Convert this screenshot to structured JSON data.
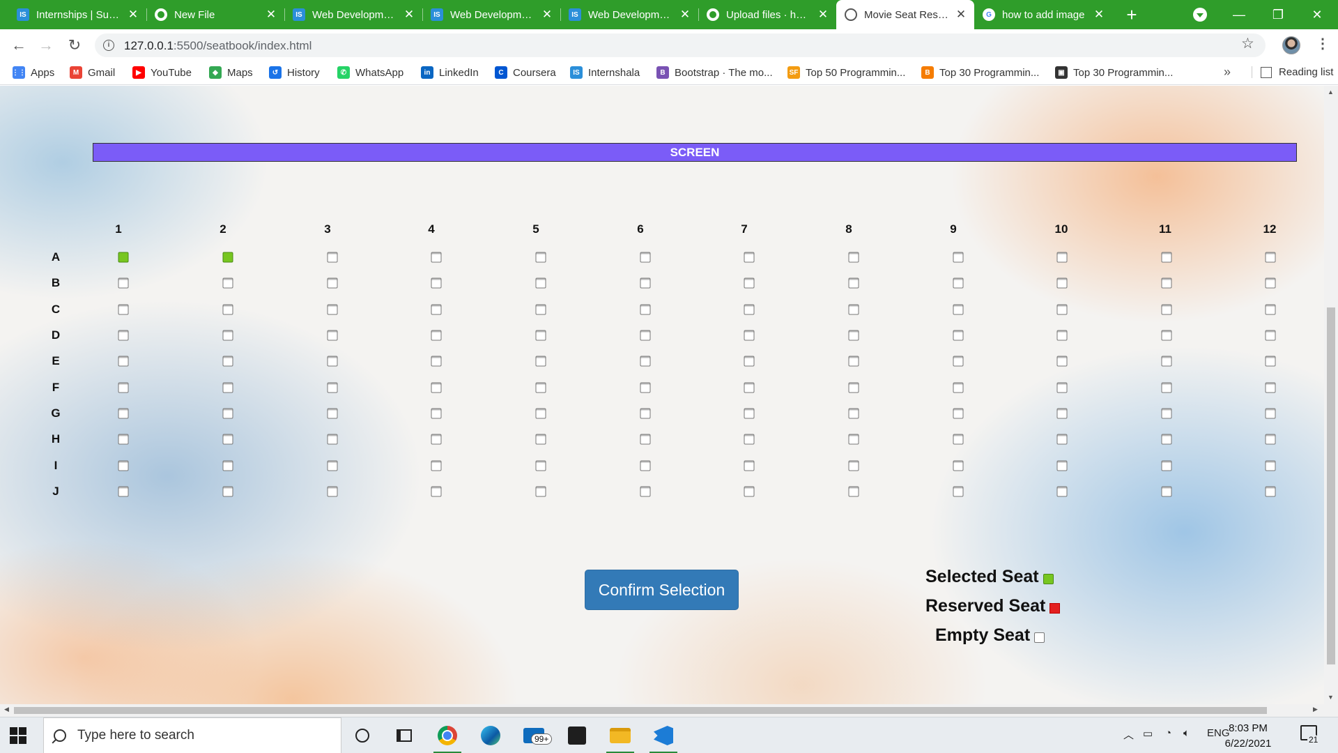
{
  "browser": {
    "tabs": [
      {
        "title": "Internships | Summer",
        "icon": "internshala-icon"
      },
      {
        "title": "New File",
        "icon": "github-icon"
      },
      {
        "title": "Web Development",
        "icon": "internshala-icon"
      },
      {
        "title": "Web Development",
        "icon": "internshala-icon"
      },
      {
        "title": "Web Development",
        "icon": "internshala-icon"
      },
      {
        "title": "Upload files · harsh",
        "icon": "github-icon"
      },
      {
        "title": "Movie Seat Reservation",
        "icon": "globe-icon",
        "active": true
      },
      {
        "title": "how to add image",
        "icon": "google-icon"
      }
    ],
    "url_host": "127.0.0.1",
    "url_path": ":5500/seatbook/index.html",
    "bookmarks": [
      {
        "label": "Apps",
        "color": "#4285f4",
        "glyph": "⋮⋮"
      },
      {
        "label": "Gmail",
        "color": "#ea4335",
        "glyph": "M"
      },
      {
        "label": "YouTube",
        "color": "#ff0000",
        "glyph": "▶"
      },
      {
        "label": "Maps",
        "color": "#34a853",
        "glyph": "◆"
      },
      {
        "label": "History",
        "color": "#1a73e8",
        "glyph": "↺"
      },
      {
        "label": "WhatsApp",
        "color": "#25d366",
        "glyph": "✆"
      },
      {
        "label": "LinkedIn",
        "color": "#0a66c2",
        "glyph": "in"
      },
      {
        "label": "Coursera",
        "color": "#0056d2",
        "glyph": "C"
      },
      {
        "label": "Internshala",
        "color": "#2b8fd9",
        "glyph": "IS"
      },
      {
        "label": "Bootstrap · The mo...",
        "color": "#7952b3",
        "glyph": "B"
      },
      {
        "label": "Top 50 Programmin...",
        "color": "#f39c12",
        "glyph": "SF"
      },
      {
        "label": "Top 30 Programmin...",
        "color": "#f57c00",
        "glyph": "B"
      },
      {
        "label": "Top 30 Programmin...",
        "color": "#333333",
        "glyph": "▣"
      }
    ],
    "reading_list": "Reading list"
  },
  "page": {
    "screen_label": "SCREEN",
    "columns": [
      "1",
      "2",
      "3",
      "4",
      "5",
      "6",
      "7",
      "8",
      "9",
      "10",
      "11",
      "12"
    ],
    "rows": [
      "A",
      "B",
      "C",
      "D",
      "E",
      "F",
      "G",
      "H",
      "I",
      "J"
    ],
    "selected_seats": [
      "A1",
      "A2"
    ],
    "reserved_seats": [],
    "confirm_button": "Confirm Selection",
    "legend": {
      "selected": "Selected Seat",
      "reserved": "Reserved Seat",
      "empty": "Empty Seat"
    },
    "colors": {
      "screen": "#7b5cf7",
      "selected": "#77c620",
      "reserved": "#e32020",
      "button": "#337ab7",
      "tabstrip": "#2f9d2a"
    }
  },
  "taskbar": {
    "search_placeholder": "Type here to search",
    "mail_badge": "99+",
    "language": "ENG",
    "time": "8:03 PM",
    "date": "6/22/2021",
    "notification_count": "21"
  }
}
